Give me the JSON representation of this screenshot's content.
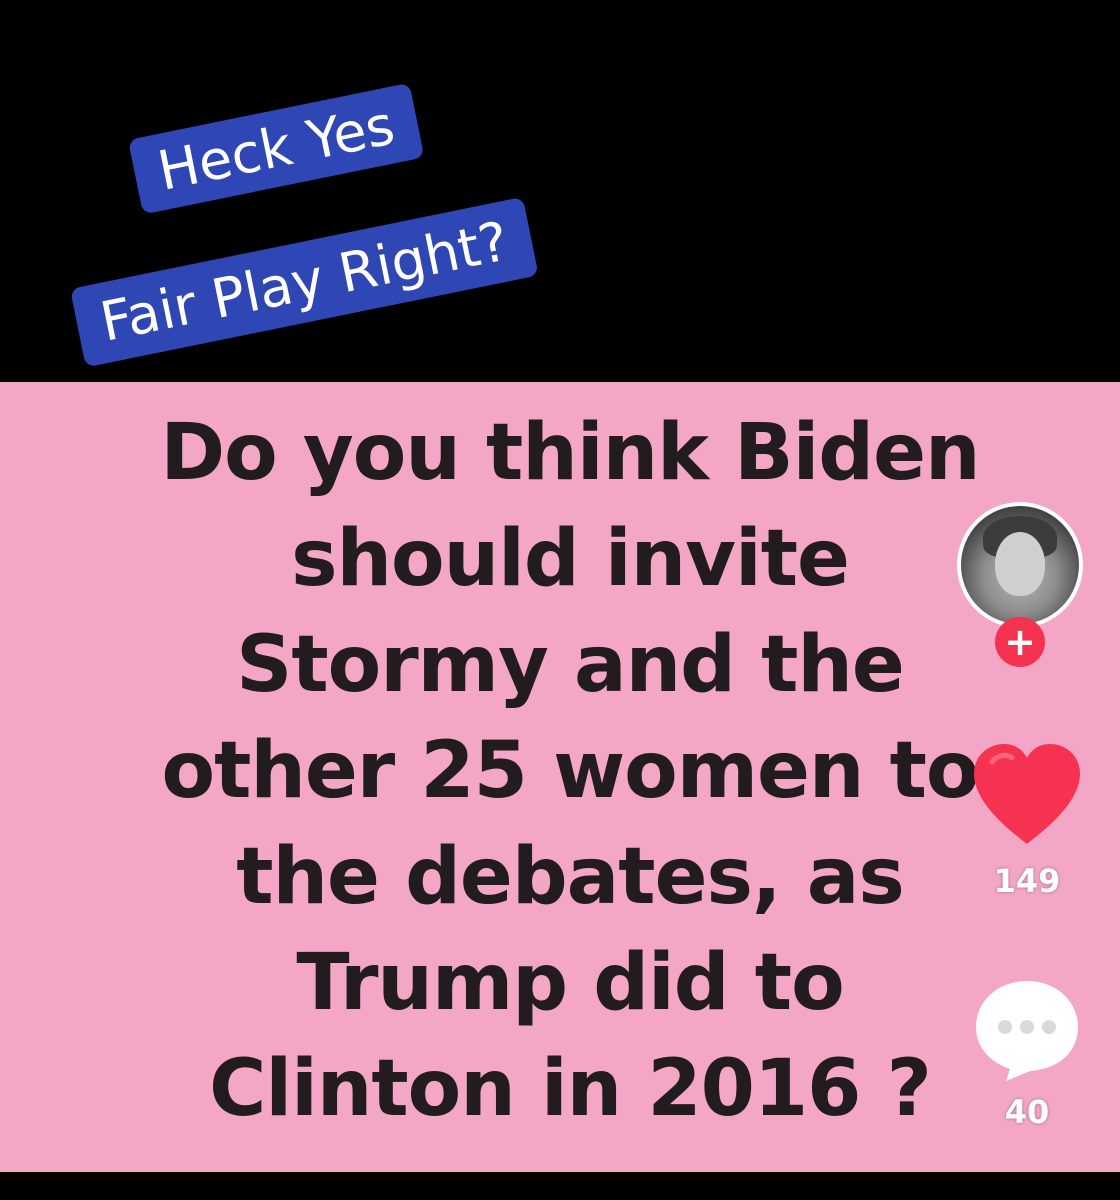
{
  "caption": {
    "line1": "Heck Yes",
    "line2": "Fair Play Right?"
  },
  "question": {
    "lines": [
      "Do you think Biden",
      "should invite",
      "Stormy and the",
      "other 25 women to",
      "the debates, as",
      "Trump did to",
      "Clinton in 2016 ?"
    ]
  },
  "actions": {
    "follow_symbol": "+",
    "like_count": "149",
    "comment_count": "40"
  },
  "colors": {
    "panel_pink": "#f3a6c5",
    "sticker_blue": "#2f47b5",
    "like_red": "#f5324f"
  },
  "icons": {
    "follow": "plus-icon",
    "like": "heart-icon",
    "comment": "speech-bubble-icon"
  }
}
